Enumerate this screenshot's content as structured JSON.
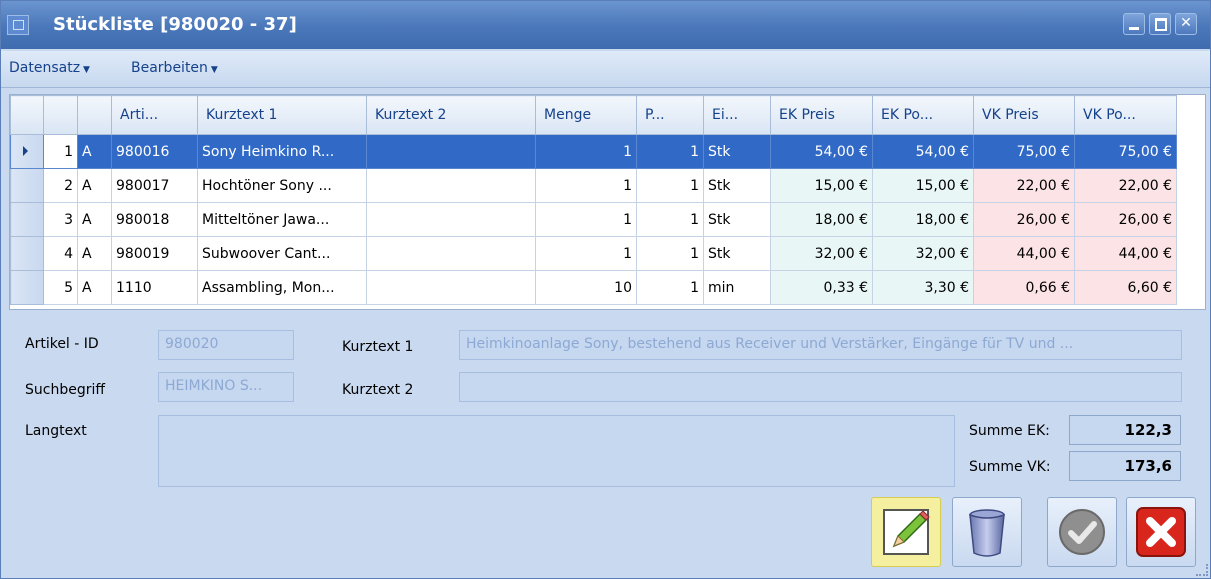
{
  "window": {
    "title": "Stückliste [980020 - 37]"
  },
  "menu": [
    {
      "label": "Datensatz"
    },
    {
      "label": "Bearbeiten"
    }
  ],
  "grid": {
    "columns": [
      "Arti...",
      "Kurztext 1",
      "Kurztext 2",
      "Menge",
      "P...",
      "Ei...",
      "EK Preis",
      "EK Po...",
      "VK Preis",
      "VK Po..."
    ],
    "rows": [
      {
        "pos": "1",
        "type": "A",
        "artikel": "980016",
        "kurztext1": "Sony Heimkino R...",
        "kurztext2": "",
        "menge": "1",
        "p": "1",
        "einheit": "Stk",
        "ek_preis": "54,00 €",
        "ek_pos": "54,00 €",
        "vk_preis": "75,00 €",
        "vk_pos": "75,00 €",
        "selected": true
      },
      {
        "pos": "2",
        "type": "A",
        "artikel": "980017",
        "kurztext1": "Hochtöner Sony ...",
        "kurztext2": "",
        "menge": "1",
        "p": "1",
        "einheit": "Stk",
        "ek_preis": "15,00 €",
        "ek_pos": "15,00 €",
        "vk_preis": "22,00 €",
        "vk_pos": "22,00 €"
      },
      {
        "pos": "3",
        "type": "A",
        "artikel": "980018",
        "kurztext1": "Mitteltöner Jawa...",
        "kurztext2": "",
        "menge": "1",
        "p": "1",
        "einheit": "Stk",
        "ek_preis": "18,00 €",
        "ek_pos": "18,00 €",
        "vk_preis": "26,00 €",
        "vk_pos": "26,00 €"
      },
      {
        "pos": "4",
        "type": "A",
        "artikel": "980019",
        "kurztext1": "Subwoover Cant...",
        "kurztext2": "",
        "menge": "1",
        "p": "1",
        "einheit": "Stk",
        "ek_preis": "32,00 €",
        "ek_pos": "32,00 €",
        "vk_preis": "44,00 €",
        "vk_pos": "44,00 €"
      },
      {
        "pos": "5",
        "type": "A",
        "artikel": "1110",
        "kurztext1": "Assambling, Mon...",
        "kurztext2": "",
        "menge": "10",
        "p": "1",
        "einheit": "min",
        "ek_preis": "0,33 €",
        "ek_pos": "3,30 €",
        "vk_preis": "0,66 €",
        "vk_pos": "6,60 €"
      }
    ]
  },
  "form": {
    "artikel_id_label": "Artikel - ID",
    "artikel_id_value": "980020",
    "kurztext1_label": "Kurztext 1",
    "kurztext1_value": "Heimkinoanlage Sony, bestehend aus Receiver und Verstärker, Eingänge für TV und ...",
    "suchbegriff_label": "Suchbegriff",
    "suchbegriff_value": "HEIMKINO S...",
    "kurztext2_label": "Kurztext 2",
    "kurztext2_value": "",
    "langtext_label": "Langtext",
    "langtext_value": "",
    "summe_ek_label": "Summe EK:",
    "summe_ek_value": "122,3",
    "summe_vk_label": "Summe VK:",
    "summe_vk_value": "173,6"
  },
  "buttons": {
    "edit_icon": "pencil-icon",
    "delete_icon": "trash-icon",
    "ok_icon": "checkmark-icon",
    "cancel_icon": "close-icon"
  },
  "colors": {
    "titlebar": "#4a77ba",
    "selected_row": "#3169c6",
    "ek_cells": "#e9f6f6",
    "vk_cells": "#fce3e6",
    "cancel_red": "#d9261c"
  }
}
